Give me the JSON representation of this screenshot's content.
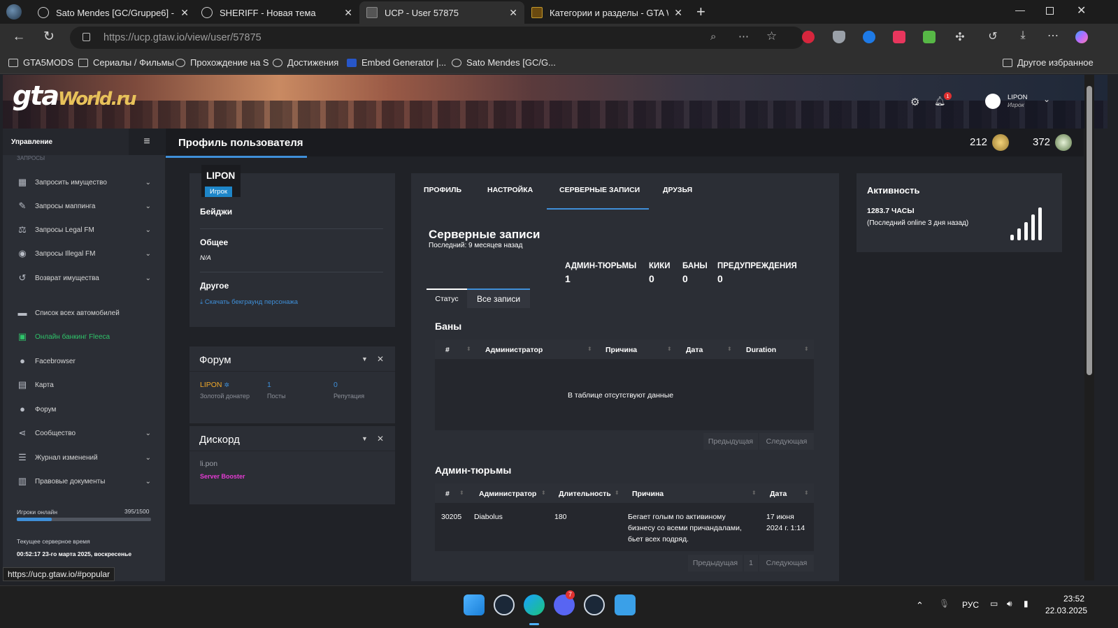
{
  "browser": {
    "tabs": [
      {
        "title": "Sato Mendes [GC/Gruppe6] - Los",
        "active": false
      },
      {
        "title": "SHERIFF - Новая тема",
        "active": false
      },
      {
        "title": "UCP - User 57875",
        "active": true
      },
      {
        "title": "Категории и разделы - GTA World",
        "active": false
      }
    ],
    "url": "https://ucp.gtaw.io/view/user/57875",
    "bookmarks": [
      "GTA5MODS",
      "Сериалы / Фильмы",
      "Прохождение на S",
      "Достижения",
      "Embed Generator |...",
      "Sato Mendes [GC/G..."
    ],
    "other_bookmarks": "Другое избранное",
    "status_url": "https://ucp.gtaw.io/#popular"
  },
  "site": {
    "logo_main": "gta",
    "logo_sub": "World.ru",
    "user": {
      "name": "LIPON",
      "role": "Игрок",
      "notifications": "1"
    },
    "page_title": "Профиль пользователя",
    "stats": [
      {
        "value": "212"
      },
      {
        "value": "372"
      }
    ]
  },
  "sidebar": {
    "heading": "Управление",
    "section": "ЗАПРОСЫ",
    "items": [
      {
        "label": "Запросить имущество",
        "icon": "building-icon",
        "expand": true
      },
      {
        "label": "Запросы маппинга",
        "icon": "brush-icon",
        "expand": true
      },
      {
        "label": "Запросы Legal FM",
        "icon": "scales-icon",
        "expand": true
      },
      {
        "label": "Запросы Illegal FM",
        "icon": "mask-icon",
        "expand": true
      },
      {
        "label": "Возврат имущества",
        "icon": "undo-icon",
        "expand": true
      },
      {
        "label": "Список всех автомобилей",
        "icon": "car-icon",
        "expand": false
      },
      {
        "label": "Онлайн банкинг Fleeca",
        "icon": "money-icon",
        "expand": false
      },
      {
        "label": "Facebrowser",
        "icon": "users-icon",
        "expand": false
      },
      {
        "label": "Карта",
        "icon": "map-icon",
        "expand": false
      },
      {
        "label": "Форум",
        "icon": "chat-icon",
        "expand": false
      },
      {
        "label": "Сообщество",
        "icon": "share-icon",
        "expand": true
      },
      {
        "label": "Журнал изменений",
        "icon": "list-icon",
        "expand": true
      },
      {
        "label": "Правовые документы",
        "icon": "document-icon",
        "expand": true
      }
    ],
    "online_label": "Игроки онлайн",
    "online_value": "395/1500",
    "online_fraction": 0.263,
    "time_label": "Текущее серверное время",
    "time_value": "00:52:17 23-го марта 2025, воскресенье"
  },
  "profile": {
    "name": "LIPON",
    "role": "Игрок",
    "badges_title": "Бейджи",
    "general_title": "Общее",
    "general_value": "N/A",
    "other_title": "Другое",
    "other_link": "Скачать бекграунд персонажа"
  },
  "forum": {
    "title": "Форум",
    "user": "LIPON",
    "user_sub": "Золотой донатер",
    "posts": "1",
    "posts_label": "Посты",
    "rep": "0",
    "rep_label": "Репутация"
  },
  "discord": {
    "title": "Дискорд",
    "user": "li.pon",
    "role": "Server Booster"
  },
  "tabs": [
    "ПРОФИЛЬ",
    "НАСТРОЙКА",
    "СЕРВЕРНЫЕ ЗАПИСИ",
    "ДРУЗЬЯ"
  ],
  "records": {
    "title": "Серверные записи",
    "subtitle": "Последний: 9 месяцев назад",
    "counters": [
      {
        "label": "АДМИН-ТЮРЬМЫ",
        "value": "1"
      },
      {
        "label": "КИКИ",
        "value": "0"
      },
      {
        "label": "БАНЫ",
        "value": "0"
      },
      {
        "label": "ПРЕДУПРЕЖДЕНИЯ",
        "value": "0"
      }
    ],
    "subtabs": [
      "Статус",
      "Все записи"
    ],
    "bans": {
      "title": "Баны",
      "headers": [
        "#",
        "Администратор",
        "Причина",
        "Дата",
        "Duration"
      ],
      "empty": "В таблице отсутствуют данные",
      "prev": "Предыдущая",
      "next": "Следующая"
    },
    "jails": {
      "title": "Админ-тюрьмы",
      "headers": [
        "#",
        "Администратор",
        "Длительность",
        "Причина",
        "Дата"
      ],
      "rows": [
        {
          "id": "30205",
          "admin": "Diabolus",
          "duration": "180",
          "reason_lines": [
            "Бегает голым по активиному",
            "бизнесу со всеми причандалами,",
            "бьет всех подряд."
          ],
          "date_lines": [
            "17 июня",
            "2024 г. 1:14"
          ]
        }
      ],
      "prev": "Предыдущая",
      "page": "1",
      "next": "Следующая"
    }
  },
  "activity": {
    "title": "Активность",
    "hours": "1283.7 ЧАСЫ",
    "last": "(Последний online 3 дня назад)"
  },
  "taskbar": {
    "lang": "РУС",
    "time": "23:52",
    "date": "22.03.2025",
    "discord_badge": "7"
  }
}
